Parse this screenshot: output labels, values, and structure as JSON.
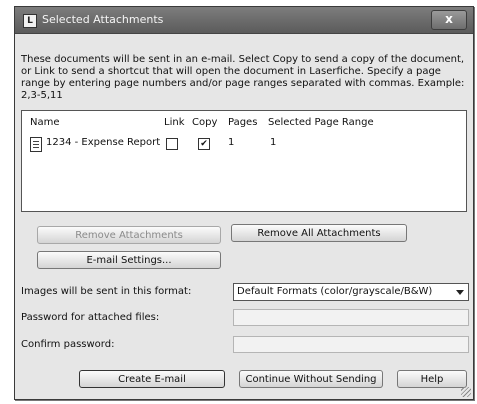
{
  "window": {
    "title": "Selected Attachments",
    "close_label": "x",
    "app_icon_label": "L"
  },
  "instructions": "These documents will be sent in an e-mail. Select Copy to send a copy of the document, or Link to send a shortcut that will open the document in Laserfiche.  Specify a page range by entering page numbers and/or page ranges separated with commas.  Example: 2,3-5,11",
  "list": {
    "columns": [
      "Name",
      "Link",
      "Copy",
      "Pages",
      "Selected Page Range"
    ],
    "rows": [
      {
        "name": "1234 - Expense Report",
        "link": "",
        "copy": "✔",
        "pages": "1",
        "range": "1"
      }
    ]
  },
  "buttons": {
    "remove_attachments": "Remove Attachments",
    "remove_all": "Remove All Attachments",
    "email_settings": "E-mail Settings...",
    "create_email": "Create E-mail",
    "continue_without_sending": "Continue Without Sending",
    "help": "Help"
  },
  "format": {
    "label": "Images will be sent in this format:",
    "selected": "Default Formats (color/grayscale/B&W)"
  },
  "password": {
    "label": "Password for attached files:",
    "confirm_label": "Confirm password:"
  }
}
